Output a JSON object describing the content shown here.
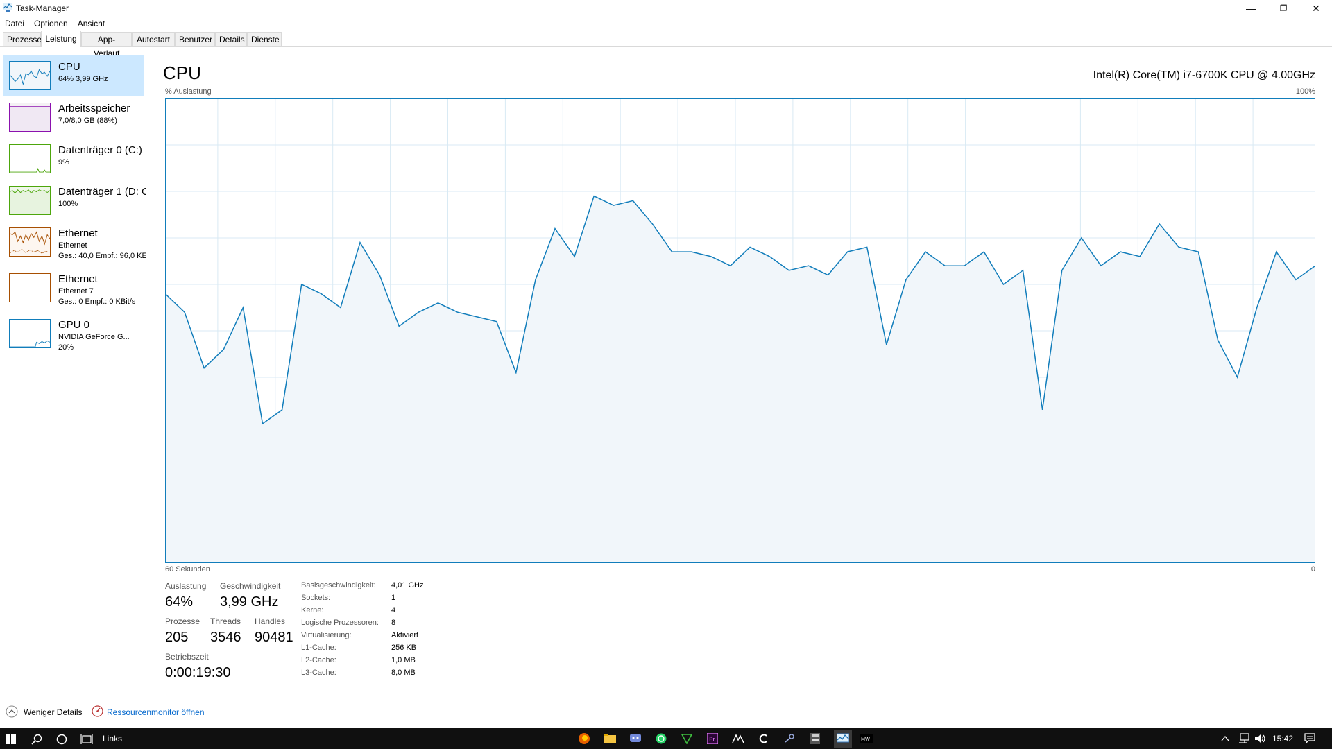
{
  "window": {
    "title": "Task-Manager",
    "minimize_glyph": "—",
    "restore_glyph": "❐",
    "close_glyph": "✕"
  },
  "menu": [
    "Datei",
    "Optionen",
    "Ansicht"
  ],
  "tabs": [
    "Prozesse",
    "Leistung",
    "App-Verlauf",
    "Autostart",
    "Benutzer",
    "Details",
    "Dienste"
  ],
  "active_tab": "Leistung",
  "sidebar": [
    {
      "name": "CPU",
      "line1": "64% 3,99 GHz",
      "line2": "",
      "color": "#117dbb",
      "selected": true
    },
    {
      "name": "Arbeitsspeicher",
      "line1": "7,0/8,0 GB (88%)",
      "line2": "",
      "color": "#8b12ae"
    },
    {
      "name": "Datenträger 0 (C:)",
      "line1": "9%",
      "line2": "",
      "color": "#4da60c"
    },
    {
      "name": "Datenträger 1 (D: C",
      "line1": "100%",
      "line2": "",
      "color": "#4da60c"
    },
    {
      "name": "Ethernet",
      "line1": "Ethernet",
      "line2": "Ges.: 40,0 Empf.: 96,0 KE",
      "color": "#a74f01"
    },
    {
      "name": "Ethernet",
      "line1": "Ethernet 7",
      "line2": "Ges.: 0 Empf.: 0 KBit/s",
      "color": "#a74f01"
    },
    {
      "name": "GPU 0",
      "line1": "NVIDIA GeForce G...",
      "line2": "20%",
      "color": "#117dbb"
    }
  ],
  "cpu": {
    "title": "CPU",
    "model": "Intel(R) Core(TM) i7-6700K CPU @ 4.00GHz",
    "graph_label_top_left": "% Auslastung",
    "graph_label_top_right": "100%",
    "graph_label_bottom_left": "60 Sekunden",
    "graph_label_bottom_right": "0",
    "graph_color": "#117dbb"
  },
  "chart_data": {
    "type": "area",
    "title": "CPU",
    "xlabel": "60 Sekunden",
    "ylabel": "% Auslastung",
    "ylim": [
      0,
      100
    ],
    "grid": true,
    "values": [
      58,
      54,
      42,
      46,
      55,
      30,
      33,
      60,
      58,
      55,
      69,
      62,
      51,
      54,
      56,
      54,
      53,
      52,
      41,
      61,
      72,
      66,
      79,
      77,
      78,
      73,
      67,
      67,
      66,
      64,
      68,
      66,
      63,
      64,
      62,
      67,
      68,
      47,
      61,
      67,
      64,
      64,
      67,
      60,
      63,
      33,
      63,
      70,
      64,
      67,
      66,
      73,
      68,
      67,
      48,
      40,
      55,
      67,
      61,
      64
    ]
  },
  "stats": {
    "auslastung_label": "Auslastung",
    "auslastung_value": "64%",
    "geschwindigkeit_label": "Geschwindigkeit",
    "geschwindigkeit_value": "3,99 GHz",
    "prozesse_label": "Prozesse",
    "prozesse_value": "205",
    "threads_label": "Threads",
    "threads_value": "3546",
    "handles_label": "Handles",
    "handles_value": "90481",
    "betriebszeit_label": "Betriebszeit",
    "betriebszeit_value": "0:00:19:30"
  },
  "details": [
    {
      "key": "Basisgeschwindigkeit:",
      "value": "4,01 GHz"
    },
    {
      "key": "Sockets:",
      "value": "1"
    },
    {
      "key": "Kerne:",
      "value": "4"
    },
    {
      "key": "Logische Prozessoren:",
      "value": "8"
    },
    {
      "key": "Virtualisierung:",
      "value": "Aktiviert"
    },
    {
      "key": "L1-Cache:",
      "value": "256 KB"
    },
    {
      "key": "L2-Cache:",
      "value": "1,0 MB"
    },
    {
      "key": "L3-Cache:",
      "value": "8,0 MB"
    }
  ],
  "footer": {
    "less_details": "Weniger Details",
    "resource_monitor": "Ressourcenmonitor öffnen",
    "link_color": "#0066cc"
  },
  "taskbar": {
    "search_label": "Links",
    "clock": "15:42",
    "pinned_icons": [
      "firefox-icon",
      "file-explorer-icon",
      "discord-icon",
      "whatsapp-icon",
      "vegas-icon",
      "premiere-icon",
      "corsair-icon",
      "ccleaner-icon",
      "steam-icon",
      "calculator-icon",
      "task-manager-icon",
      "msi-afterburner-icon"
    ]
  }
}
